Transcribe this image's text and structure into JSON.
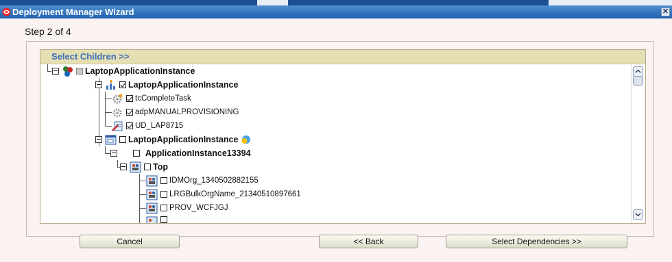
{
  "window": {
    "title": "Deployment Manager Wizard"
  },
  "step_label": "Step 2 of 4",
  "tree_header": "Select Children >>",
  "tree": [
    {
      "label": "LaptopApplicationInstance",
      "bold": true,
      "checked": "grey",
      "icon": "app-instance-icon",
      "level": 0
    },
    {
      "label": "LaptopApplicationInstance",
      "bold": true,
      "checked": true,
      "icon": "process-icon",
      "level": 1
    },
    {
      "label": "tcCompleteTask",
      "bold": false,
      "checked": true,
      "icon": "task-gear-icon",
      "level": 2
    },
    {
      "label": "adpMANUALPROVISIONING",
      "bold": false,
      "checked": true,
      "icon": "adapter-gear-icon",
      "level": 2
    },
    {
      "label": "UD_LAP8715",
      "bold": false,
      "checked": true,
      "icon": "form-icon",
      "level": 2
    },
    {
      "label": "LaptopApplicationInstance",
      "bold": true,
      "checked": false,
      "icon": "app-window-icon",
      "level": 1
    },
    {
      "label": "ApplicationInstance13394",
      "bold": true,
      "checked": false,
      "icon": null,
      "level": 2
    },
    {
      "label": "Top",
      "bold": true,
      "checked": false,
      "icon": "organization-icon",
      "level": 3
    },
    {
      "label": "IDMOrg_1340502882155",
      "bold": false,
      "checked": false,
      "icon": "organization-icon",
      "level": 4
    },
    {
      "label": "LRGBulkOrgName_21340510897661",
      "bold": false,
      "checked": false,
      "icon": "organization-icon",
      "level": 4
    },
    {
      "label": "PROV_WCFJGJ",
      "bold": false,
      "checked": false,
      "icon": "organization-icon",
      "level": 4
    }
  ],
  "buttons": {
    "cancel": "Cancel",
    "back": "<< Back",
    "select_dependencies": "Select Dependencies >>"
  },
  "colors": {
    "titlebar": "#1f5fae",
    "header_bg": "#e5dfb4",
    "header_text": "#3a6fb8",
    "background": "#fbf3f1"
  }
}
